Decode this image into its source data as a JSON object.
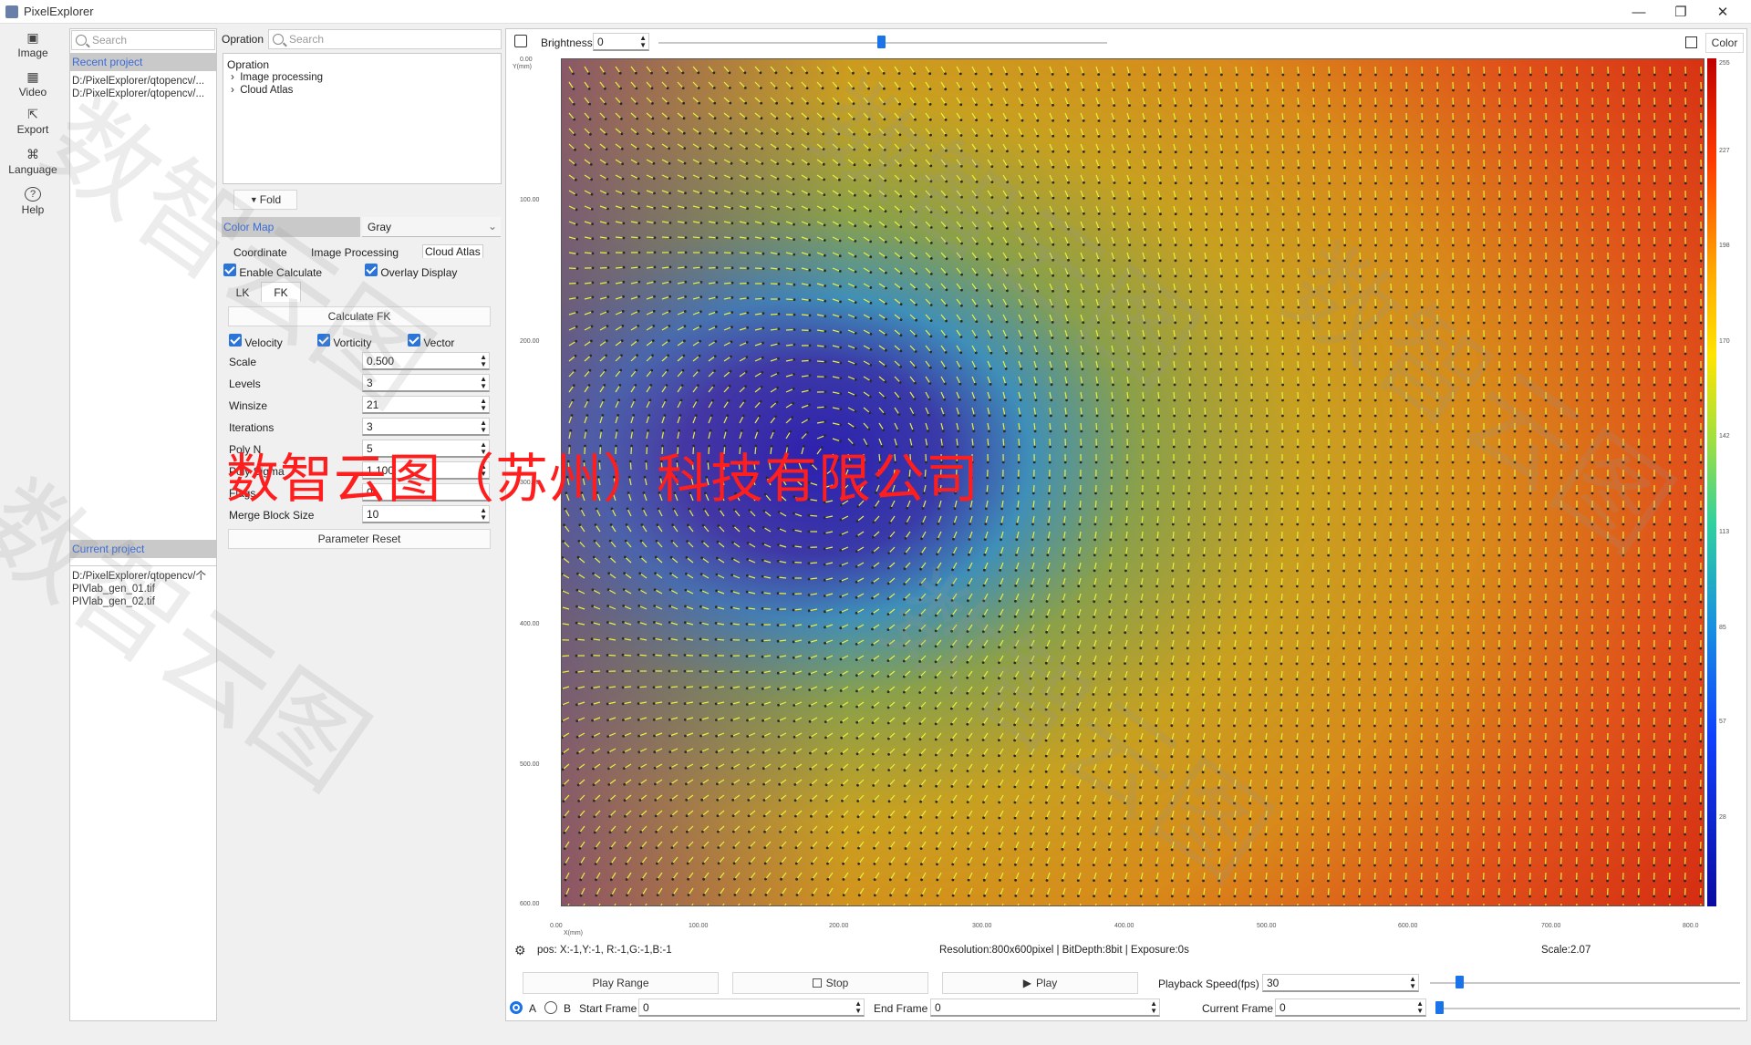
{
  "window": {
    "title": "PixelExplorer",
    "minimize": "—",
    "restore": "❐",
    "close": "✕"
  },
  "rail": [
    {
      "label": "Image",
      "icon": "image-icon",
      "glyph": "▣"
    },
    {
      "label": "Video",
      "icon": "video-icon",
      "glyph": "▦"
    },
    {
      "label": "Export",
      "icon": "export-icon",
      "glyph": "⇱"
    },
    {
      "label": "Language",
      "icon": "language-icon",
      "glyph": "⌘"
    },
    {
      "label": "Help",
      "icon": "help-icon",
      "glyph": "?"
    }
  ],
  "recent": {
    "search_placeholder": "Search",
    "header": "Recent project",
    "items": [
      "D:/PixelExplorer/qtopencv/...",
      "D:/PixelExplorer/qtopencv/..."
    ],
    "current_header": "Current project",
    "current_items": [
      "D:/PixelExplorer/qtopencv/个",
      "PIVlab_gen_01.tif",
      "PIVlab_gen_02.tif"
    ]
  },
  "operation": {
    "label": "Opration",
    "search_placeholder": "Search",
    "tree_title": "Opration",
    "tree_items": [
      "Image processing",
      "Cloud Atlas"
    ],
    "fold": "Fold",
    "colormap_label": "Color Map",
    "colormap_value": "Gray",
    "tabs": [
      "Coordinate",
      "Image Processing",
      "Cloud Atlas"
    ],
    "enable_calculate": "Enable Calculate",
    "overlay_display": "Overlay Display",
    "subtabs": [
      "LK",
      "FK"
    ],
    "calculate_btn": "Calculate FK",
    "checks": [
      "Velocity",
      "Vorticity",
      "Vector"
    ],
    "params": [
      {
        "label": "Scale",
        "value": "0.500"
      },
      {
        "label": "Levels",
        "value": "3"
      },
      {
        "label": "Winsize",
        "value": "21"
      },
      {
        "label": "Iterations",
        "value": "3"
      },
      {
        "label": "Poly N",
        "value": "5"
      },
      {
        "label": "Poly Sigma",
        "value": "1.100"
      },
      {
        "label": "Flags",
        "value": "0"
      },
      {
        "label": "Merge Block Size",
        "value": "10"
      }
    ],
    "reset_btn": "Parameter Reset"
  },
  "viewer": {
    "brightness_label": "Brightness",
    "brightness_value": "0",
    "brightness": 0.5,
    "color_btn": "Color",
    "y_axis_label": "Y(mm)",
    "x_axis_label": "X(mm)",
    "y_ticks": [
      "0.00",
      "100.00",
      "200.00",
      "300.00",
      "400.00",
      "500.00",
      "600.00"
    ],
    "x_ticks": [
      "0.00",
      "100.00",
      "200.00",
      "300.00",
      "400.00",
      "500.00",
      "600.00",
      "700.00",
      "800.0"
    ],
    "cbar_ticks": [
      "255",
      "227",
      "198",
      "170",
      "142",
      "113",
      "85",
      "57",
      "28"
    ],
    "pos": "pos: X:-1,Y:-1, R:-1,G:-1,B:-1",
    "info": "Resolution:800x600pixel | BitDepth:8bit | Exposure:0s",
    "scale": "Scale:2.07"
  },
  "playback": {
    "play_range": "Play Range",
    "stop": "Stop",
    "play": "Play",
    "speed_label": "Playback Speed(fps)",
    "speed_value": "30",
    "radio_a": "A",
    "radio_b": "B",
    "start_label": "Start Frame",
    "start_value": "0",
    "end_label": "End Frame",
    "end_value": "0",
    "current_label": "Current Frame",
    "current_value": "0"
  },
  "overlay_text": "数智云图（苏州）科技有限公司",
  "watermark": "数智云图"
}
